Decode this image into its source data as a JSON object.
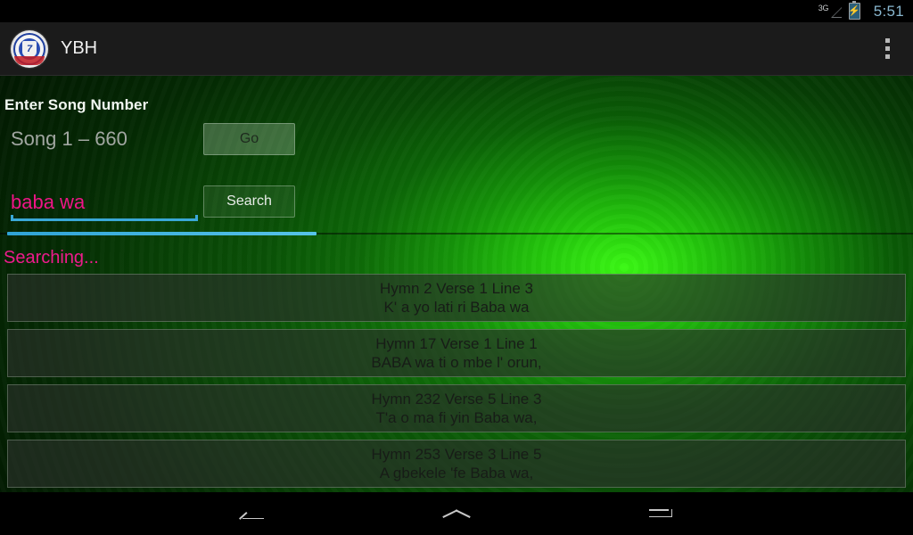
{
  "status_bar": {
    "network_label": "3G",
    "battery_icon": "battery-charging-icon",
    "signal_icon": "signal-3g-icon",
    "clock": "5:51"
  },
  "action_bar": {
    "logo_icon": "app-logo-icon",
    "title": "YBH",
    "overflow_icon": "overflow-menu-icon"
  },
  "form": {
    "song_number_label": "Enter Song Number",
    "song_number_value": "",
    "song_number_placeholder": "Song 1 – 660",
    "go_label": "Go",
    "search_value": "baba wa",
    "search_placeholder": "",
    "search_label": "Search"
  },
  "progress": {
    "percent": 34
  },
  "status": {
    "searching_text": "Searching..."
  },
  "results": [
    {
      "title": "Hymn 2 Verse 1 Line 3",
      "line": "K' a yo lati ri Baba wa"
    },
    {
      "title": "Hymn 17 Verse 1 Line 1",
      "line": "BABA wa ti o mbe l' orun,"
    },
    {
      "title": "Hymn 232 Verse 5 Line 3",
      "line": "T'a o ma fi yin Baba wa,"
    },
    {
      "title": "Hymn 253 Verse 3 Line 5",
      "line": "A gbekele 'fe Baba wa,"
    }
  ],
  "nav_bar": {
    "back_icon": "back-arrow-icon",
    "home_icon": "home-chevron-icon",
    "recents_icon": "recents-icon"
  },
  "colors": {
    "accent_pink": "#ee1587",
    "accent_blue": "#3aa8d8",
    "background_green": "#1c8a10",
    "action_bar": "#1b1b1b"
  }
}
